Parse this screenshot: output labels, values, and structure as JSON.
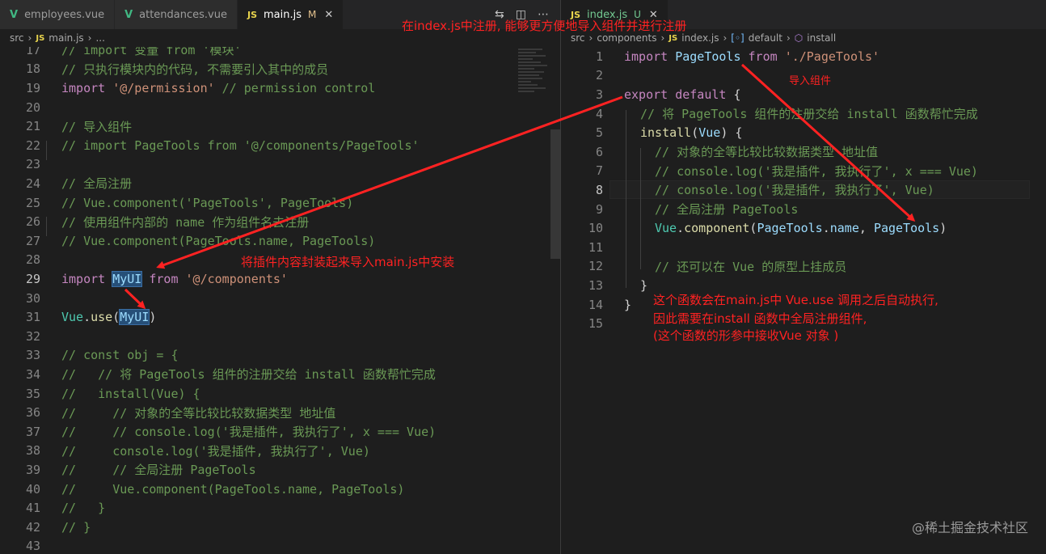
{
  "left": {
    "tabs": [
      {
        "icon": "V",
        "label": "employees.vue",
        "active": false
      },
      {
        "icon": "V",
        "label": "attendances.vue",
        "active": false
      },
      {
        "icon": "JS",
        "label": "main.js",
        "status": "M",
        "active": true
      }
    ],
    "breadcrumb": {
      "folder": "src",
      "file": "main.js",
      "rest": "..."
    },
    "lines": [
      {
        "n": "17",
        "text": "// import 变量 from '模块'"
      },
      {
        "n": "18",
        "text": "// 只执行模块内的代码, 不需要引入其中的成员"
      },
      {
        "n": "19",
        "kw": "import",
        "str": " '@/permission'",
        "cm": " // permission control"
      },
      {
        "n": "20",
        "text": ""
      },
      {
        "n": "21",
        "text": "// 导入组件"
      },
      {
        "n": "22",
        "text": "// import PageTools from '@/components/PageTools'"
      },
      {
        "n": "23",
        "text": ""
      },
      {
        "n": "24",
        "text": "// 全局注册"
      },
      {
        "n": "25",
        "text": "// Vue.component('PageTools', PageTools)"
      },
      {
        "n": "26",
        "text": "// 使用组件内部的 name 作为组件名去注册"
      },
      {
        "n": "27",
        "text": "// Vue.component(PageTools.name, PageTools)"
      },
      {
        "n": "28",
        "text": ""
      },
      {
        "n": "29",
        "kw": "import",
        "id": "MyUI",
        "kw2": "from",
        "str": "'@/components'"
      },
      {
        "n": "30",
        "text": ""
      },
      {
        "n": "31",
        "obj": "Vue",
        "fn": "use",
        "arg": "MyUI"
      },
      {
        "n": "32",
        "text": ""
      },
      {
        "n": "33",
        "text": "// const obj = {"
      },
      {
        "n": "34",
        "text": "//   // 将 PageTools 组件的注册交给 install 函数帮忙完成"
      },
      {
        "n": "35",
        "text": "//   install(Vue) {"
      },
      {
        "n": "36",
        "text": "//     // 对象的全等比较比较数据类型 地址值"
      },
      {
        "n": "37",
        "text": "//     // console.log('我是插件, 我执行了', x === Vue)"
      },
      {
        "n": "38",
        "text": "//     console.log('我是插件, 我执行了', Vue)"
      },
      {
        "n": "39",
        "text": "//     // 全局注册 PageTools"
      },
      {
        "n": "40",
        "text": "//     Vue.component(PageTools.name, PageTools)"
      },
      {
        "n": "41",
        "text": "//   }"
      },
      {
        "n": "42",
        "text": "// }"
      },
      {
        "n": "43",
        "text": ""
      }
    ]
  },
  "right": {
    "tab": {
      "icon": "JS",
      "label": "index.js",
      "status": "U"
    },
    "breadcrumb": {
      "folder1": "src",
      "folder2": "components",
      "file": "index.js",
      "sym1": "default",
      "sym2": "install"
    },
    "lines": [
      {
        "n": "1"
      },
      {
        "n": "2"
      },
      {
        "n": "3"
      },
      {
        "n": "4"
      },
      {
        "n": "5"
      },
      {
        "n": "6"
      },
      {
        "n": "7"
      },
      {
        "n": "8"
      },
      {
        "n": "9"
      },
      {
        "n": "10"
      },
      {
        "n": "11"
      },
      {
        "n": "12"
      },
      {
        "n": "13"
      },
      {
        "n": "14"
      },
      {
        "n": "15"
      }
    ],
    "code": {
      "l1_kw": "import",
      "l1_id": "PageTools",
      "l1_from": "from",
      "l1_str": "'./PageTools'",
      "l3_kw1": "export",
      "l3_kw2": "default",
      "l3_brace": "{",
      "l4": "// 将 PageTools 组件的注册交给 install 函数帮忙完成",
      "l5_fn": "install",
      "l5_arg": "Vue",
      "l5_rest": ") {",
      "l6": "// 对象的全等比较比较数据类型 地址值",
      "l7": "// console.log('我是插件, 我执行了', x === Vue)",
      "l8": "// console.log('我是插件, 我执行了', Vue)",
      "l9": "// 全局注册 PageTools",
      "l10_obj": "Vue",
      "l10_fn": "component",
      "l10_a": "PageTools",
      "l10_b": "name",
      "l10_c": "PageTools",
      "l12": "// 还可以在 Vue 的原型上挂成员",
      "l13": "}",
      "l14": "}"
    }
  },
  "annotations": {
    "top": "在index.js中注册, 能够更方便地导入组件并进行注册",
    "import_component": "导入组件",
    "package": "将插件内容封装起来导入main.js中安装",
    "explain1": "这个函数会在main.js中 Vue.use 调用之后自动执行,",
    "explain2": "因此需要在install 函数中全局注册组件,",
    "explain3": "(这个函数的形参中接收Vue 对象 )"
  },
  "watermark": "@稀土掘金技术社区",
  "colors": {
    "annotation": "#ff2222",
    "background": "#1e1e1e"
  }
}
